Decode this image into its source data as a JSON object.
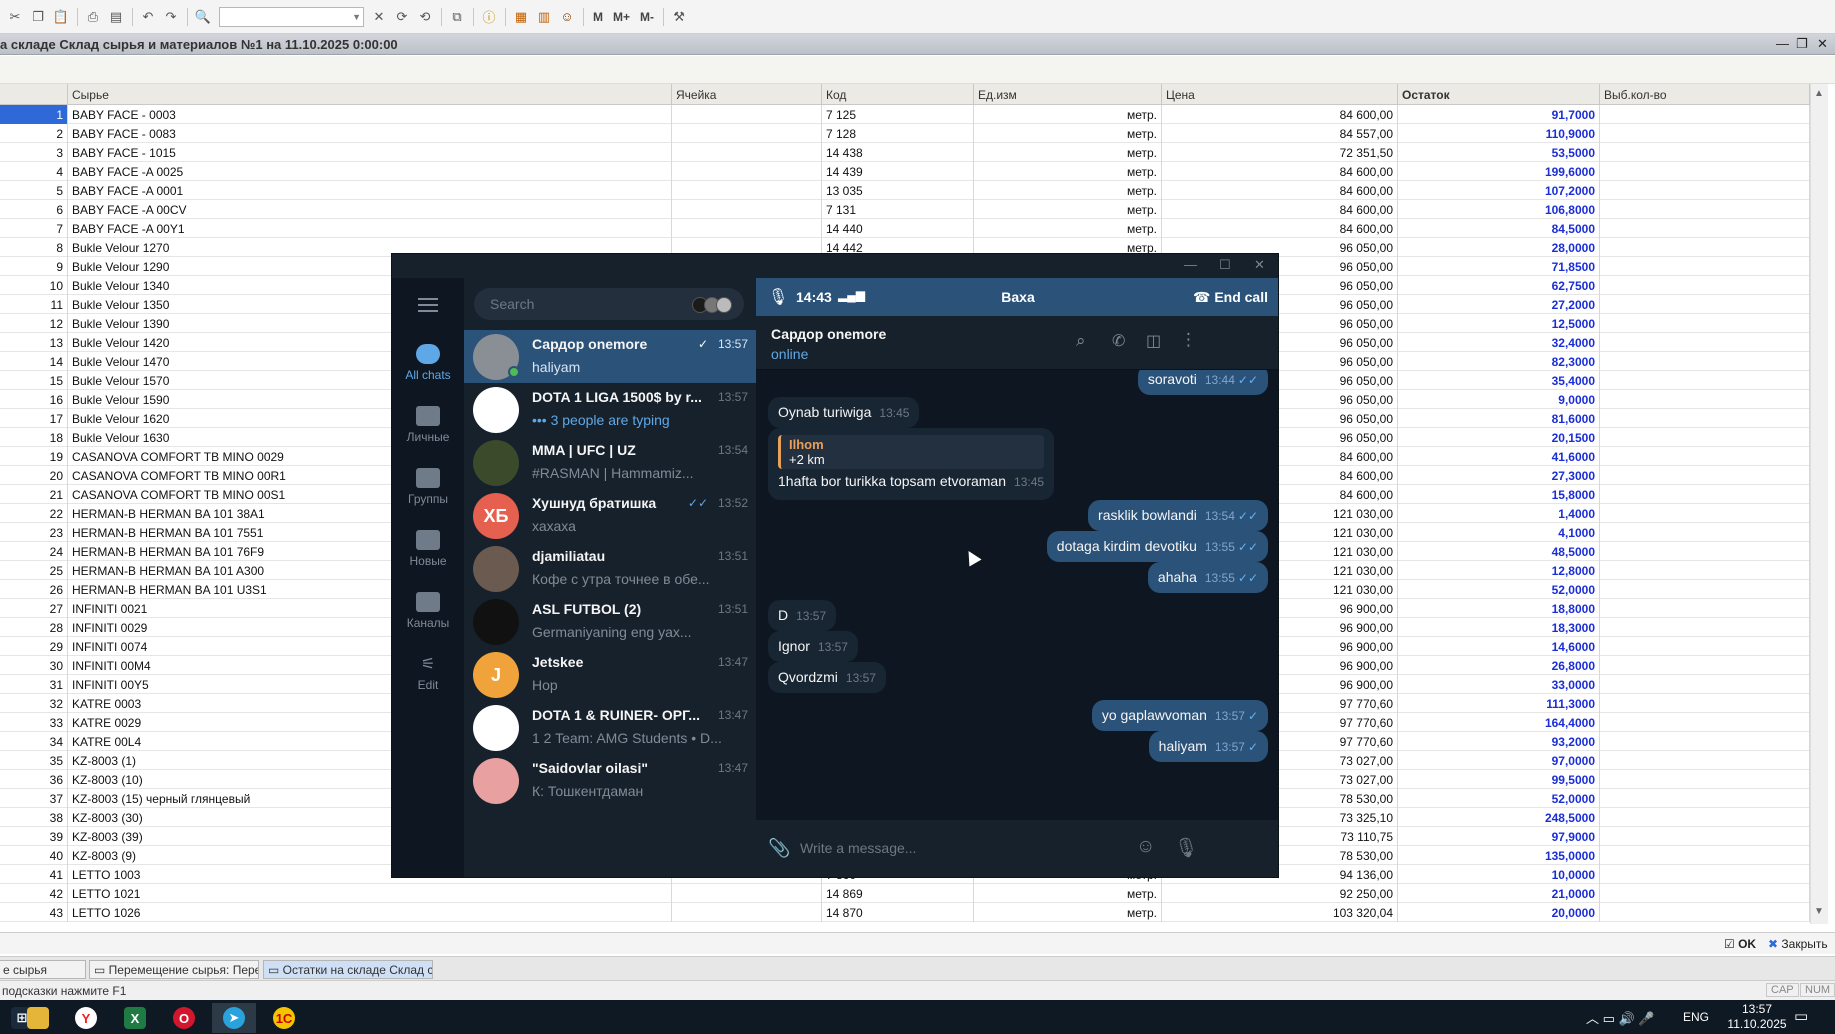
{
  "onec": {
    "title": "а складе Склад сырья и материалов №1 на 11.10.2025 0:00:00",
    "columns": [
      "",
      "Сырье",
      "Ячейка",
      "Код",
      "Ед.изм",
      "Цена",
      "Остаток",
      "Выб.кол-во"
    ],
    "rows": [
      [
        "1",
        "BABY FACE - 0003",
        "",
        "7 125",
        "метр.",
        "84 600,00",
        "91,7000",
        ""
      ],
      [
        "2",
        "BABY FACE - 0083",
        "",
        "7 128",
        "метр.",
        "84 557,00",
        "110,9000",
        ""
      ],
      [
        "3",
        "BABY FACE - 1015",
        "",
        "14 438",
        "метр.",
        "72 351,50",
        "53,5000",
        ""
      ],
      [
        "4",
        "BABY FACE -A  0025",
        "",
        "14 439",
        "метр.",
        "84 600,00",
        "199,6000",
        ""
      ],
      [
        "5",
        "BABY FACE -A 0001",
        "",
        "13 035",
        "метр.",
        "84 600,00",
        "107,2000",
        ""
      ],
      [
        "6",
        "BABY FACE -A 00CV",
        "",
        "7 131",
        "метр.",
        "84 600,00",
        "106,8000",
        ""
      ],
      [
        "7",
        "BABY FACE -A 00Y1",
        "",
        "14 440",
        "метр.",
        "84 600,00",
        "84,5000",
        ""
      ],
      [
        "8",
        "Bukle Velour 1270",
        "",
        "14 442",
        "метр.",
        "96 050,00",
        "28,0000",
        ""
      ],
      [
        "9",
        "Bukle Velour 1290",
        "",
        "",
        "",
        "96 050,00",
        "71,8500",
        ""
      ],
      [
        "10",
        "Bukle Velour 1340",
        "",
        "",
        "",
        "96 050,00",
        "62,7500",
        ""
      ],
      [
        "11",
        "Bukle Velour 1350",
        "",
        "",
        "",
        "96 050,00",
        "27,2000",
        ""
      ],
      [
        "12",
        "Bukle Velour 1390",
        "",
        "",
        "",
        "96 050,00",
        "12,5000",
        ""
      ],
      [
        "13",
        "Bukle Velour 1420",
        "",
        "",
        "",
        "96 050,00",
        "32,4000",
        ""
      ],
      [
        "14",
        "Bukle Velour 1470",
        "",
        "",
        "",
        "96 050,00",
        "82,3000",
        ""
      ],
      [
        "15",
        "Bukle Velour 1570",
        "",
        "",
        "",
        "96 050,00",
        "35,4000",
        ""
      ],
      [
        "16",
        "Bukle Velour 1590",
        "",
        "",
        "",
        "96 050,00",
        "9,0000",
        ""
      ],
      [
        "17",
        "Bukle Velour 1620",
        "",
        "",
        "",
        "96 050,00",
        "81,6000",
        ""
      ],
      [
        "18",
        "Bukle Velour 1630",
        "",
        "",
        "",
        "96 050,00",
        "20,1500",
        ""
      ],
      [
        "19",
        "CASANOVA COMFORT TB MINO 0029",
        "",
        "",
        "",
        "84 600,00",
        "41,6000",
        ""
      ],
      [
        "20",
        "CASANOVA COMFORT TB MINO 00R1",
        "",
        "",
        "",
        "84 600,00",
        "27,3000",
        ""
      ],
      [
        "21",
        "CASANOVA COMFORT TB MINO 00S1",
        "",
        "",
        "",
        "84 600,00",
        "15,8000",
        ""
      ],
      [
        "22",
        "HERMAN-B HERMAN BA 101 38A1",
        "",
        "",
        "",
        "121 030,00",
        "1,4000",
        ""
      ],
      [
        "23",
        "HERMAN-B HERMAN BA 101 7551",
        "",
        "",
        "",
        "121 030,00",
        "4,1000",
        ""
      ],
      [
        "24",
        "HERMAN-B HERMAN BA 101 76F9",
        "",
        "",
        "",
        "121 030,00",
        "48,5000",
        ""
      ],
      [
        "25",
        "HERMAN-B HERMAN BA 101 A300",
        "",
        "",
        "",
        "121 030,00",
        "12,8000",
        ""
      ],
      [
        "26",
        "HERMAN-B HERMAN BA 101 U3S1",
        "",
        "",
        "",
        "121 030,00",
        "52,0000",
        ""
      ],
      [
        "27",
        "INFINITI 0021",
        "",
        "",
        "",
        "96 900,00",
        "18,8000",
        ""
      ],
      [
        "28",
        "INFINITI 0029",
        "",
        "",
        "",
        "96 900,00",
        "18,3000",
        ""
      ],
      [
        "29",
        "INFINITI 0074",
        "",
        "",
        "",
        "96 900,00",
        "14,6000",
        ""
      ],
      [
        "30",
        "INFINITI 00M4",
        "",
        "",
        "",
        "96 900,00",
        "26,8000",
        ""
      ],
      [
        "31",
        "INFINITI 00Y5",
        "",
        "",
        "",
        "96 900,00",
        "33,0000",
        ""
      ],
      [
        "32",
        "KATRE 0003",
        "",
        "",
        "",
        "97 770,60",
        "111,3000",
        ""
      ],
      [
        "33",
        "KATRE 0029",
        "",
        "",
        "",
        "97 770,60",
        "164,4000",
        ""
      ],
      [
        "34",
        "KATRE 00L4",
        "",
        "",
        "",
        "97 770,60",
        "93,2000",
        ""
      ],
      [
        "35",
        "KZ-8003 (1)",
        "",
        "",
        "",
        "73 027,00",
        "97,0000",
        ""
      ],
      [
        "36",
        "KZ-8003 (10)",
        "",
        "",
        "",
        "73 027,00",
        "99,5000",
        ""
      ],
      [
        "37",
        "KZ-8003 (15) черный глянцевый",
        "",
        "",
        "",
        "78 530,00",
        "52,0000",
        ""
      ],
      [
        "38",
        "KZ-8003 (30)",
        "",
        "",
        "",
        "73 325,10",
        "248,5000",
        ""
      ],
      [
        "39",
        "KZ-8003 (39)",
        "",
        "",
        "",
        "73 110,75",
        "97,9000",
        ""
      ],
      [
        "40",
        "KZ-8003 (9)",
        "",
        "",
        "",
        "78 530,00",
        "135,0000",
        ""
      ],
      [
        "41",
        "LETTO 1003",
        "",
        "7 860",
        "метр.",
        "94 136,00",
        "10,0000",
        ""
      ],
      [
        "42",
        "LETTO 1021",
        "",
        "14 869",
        "метр.",
        "92 250,00",
        "21,0000",
        ""
      ],
      [
        "43",
        "LETTO 1026",
        "",
        "14 870",
        "метр.",
        "103 320,04",
        "20,0000",
        ""
      ]
    ],
    "ok_label": "OK",
    "close_label": "Закрыть",
    "window_tabs": [
      "е сырья",
      "Перемещение сырья: Пере...",
      "Остатки на складе Склад с..."
    ],
    "status_text": "подсказки нажмите F1",
    "indicators": [
      "CAP",
      "NUM"
    ]
  },
  "taskbar": {
    "time": "13:57",
    "date": "11.10.2025",
    "lang": "ENG"
  },
  "telegram": {
    "search_placeholder": "Search",
    "folders": [
      "All chats",
      "Личные",
      "Группы",
      "Новые",
      "Каналы",
      "Edit"
    ],
    "chats": [
      {
        "name": "Сардор onemore",
        "time": "13:57",
        "msg": "haliyam",
        "initials": "",
        "color": "#8a8f96",
        "read": "✓"
      },
      {
        "name": "DOTA 1 LIGA 1500$ by r...",
        "time": "13:57",
        "msg": "••• 3 people are typing",
        "initials": "",
        "color": "#ffffff",
        "read": ""
      },
      {
        "name": "MMA | UFC | UZ",
        "time": "13:54",
        "msg": "#RASMAN | Hammamiz...",
        "initials": "",
        "color": "#3a4a2a",
        "read": ""
      },
      {
        "name": "Хушнуд братишка",
        "time": "13:52",
        "msg": "хахаха",
        "initials": "ХБ",
        "color": "#e5604f",
        "read": "✓✓"
      },
      {
        "name": "djamiliatau",
        "time": "13:51",
        "msg": "Кофе с утра  точнее в обе...",
        "initials": "",
        "color": "#6b5a50",
        "read": ""
      },
      {
        "name": "ASL FUTBOL (2)",
        "time": "13:51",
        "msg": "Germaniyaning eng yax...",
        "initials": "",
        "color": "#111111",
        "read": ""
      },
      {
        "name": "Jetskee",
        "time": "13:47",
        "msg": "Нор",
        "initials": "J",
        "color": "#f0a33a",
        "read": ""
      },
      {
        "name": "DOTA 1 & RUINER- ОРГ...",
        "time": "13:47",
        "msg": "1 2 Team: AMG Students • D...",
        "initials": "",
        "color": "#ffffff",
        "read": ""
      },
      {
        "name": "\"Saidovlar oilasi\"",
        "time": "13:47",
        "msg": "К: Тошкентдаман",
        "initials": "",
        "color": "#e8a0a0",
        "read": ""
      }
    ],
    "call": {
      "duration": "14:43",
      "name": "Ваха",
      "end_label": "End call"
    },
    "header": {
      "name": "Сардор onemore",
      "status": "online"
    },
    "messages": [
      {
        "dir": "out",
        "text": "soravoti",
        "time": "13:44",
        "ticks": "✓✓"
      },
      {
        "dir": "in",
        "text": "Oynab turiwiga",
        "time": "13:45"
      },
      {
        "dir": "in",
        "reply_name": "Ilhom",
        "reply_text": "+2 km",
        "text": "1hafta bor turikka topsam etvoraman",
        "time": "13:45"
      },
      {
        "dir": "out",
        "text": "rasklik bowlandi",
        "time": "13:54",
        "ticks": "✓✓"
      },
      {
        "dir": "out",
        "text": "dotaga kirdim devotiku",
        "time": "13:55",
        "ticks": "✓✓"
      },
      {
        "dir": "out",
        "text": "ahaha",
        "time": "13:55",
        "ticks": "✓✓"
      },
      {
        "dir": "in",
        "text": "D",
        "time": "13:57"
      },
      {
        "dir": "in",
        "text": "Ignor",
        "time": "13:57"
      },
      {
        "dir": "in",
        "text": "Qvordzmi",
        "time": "13:57"
      },
      {
        "dir": "out",
        "text": "yo gaplawvoman",
        "time": "13:57",
        "ticks": "✓"
      },
      {
        "dir": "out",
        "text": "haliyam",
        "time": "13:57",
        "ticks": "✓"
      }
    ],
    "composer_placeholder": "Write a message..."
  }
}
